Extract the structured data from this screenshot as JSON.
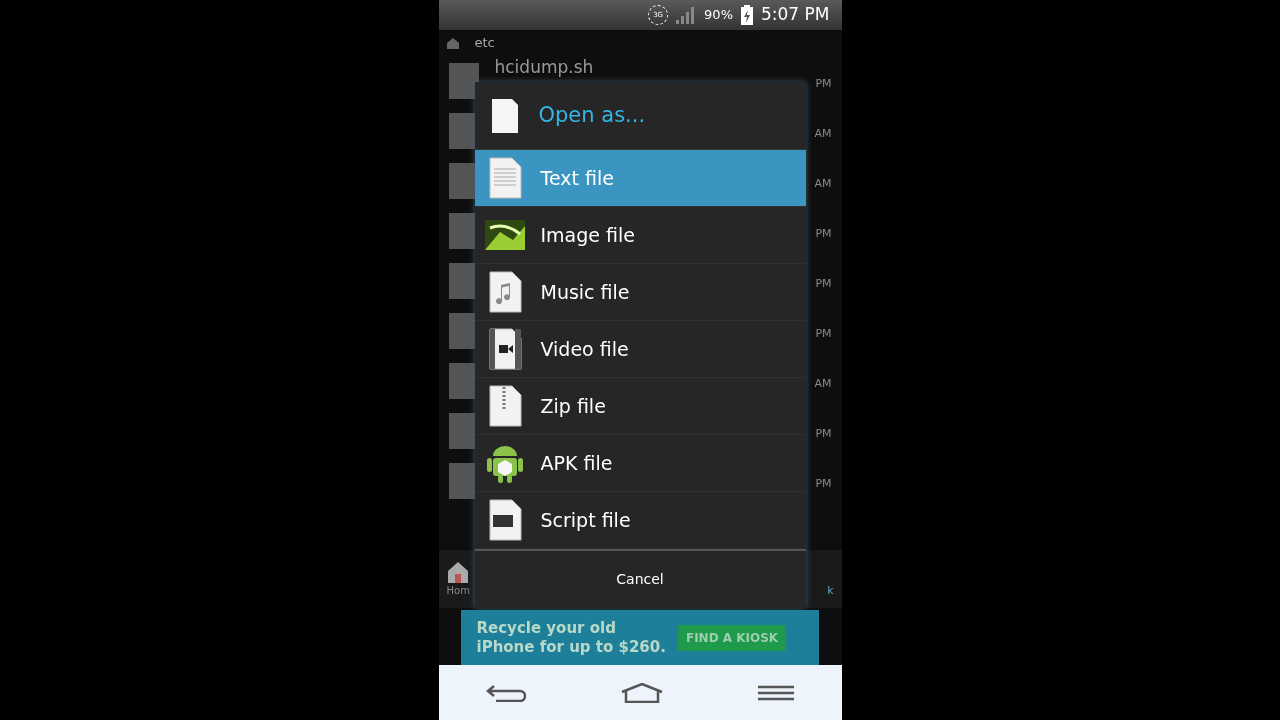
{
  "status_bar": {
    "network": "3G",
    "battery": "90%",
    "time": "5:07 PM"
  },
  "breadcrumb": "etc",
  "files": [
    {
      "name": "hcidump.sh",
      "time": "PM"
    },
    {
      "time": "AM"
    },
    {
      "time": "AM"
    },
    {
      "time": "PM"
    },
    {
      "time": "PM"
    },
    {
      "time": "PM"
    },
    {
      "time": "AM"
    },
    {
      "time": "PM"
    },
    {
      "time": "PM"
    }
  ],
  "bottom_bar": {
    "left": "Hom",
    "right": "k"
  },
  "dialog": {
    "title": "Open as...",
    "items": [
      {
        "kind": "text",
        "label": "Text file",
        "selected": true
      },
      {
        "kind": "image",
        "label": "Image file",
        "selected": false
      },
      {
        "kind": "music",
        "label": "Music file",
        "selected": false
      },
      {
        "kind": "video",
        "label": "Video file",
        "selected": false
      },
      {
        "kind": "zip",
        "label": "Zip file",
        "selected": false
      },
      {
        "kind": "apk",
        "label": "APK file",
        "selected": false
      },
      {
        "kind": "script",
        "label": "Script file",
        "selected": false
      }
    ],
    "cancel": "Cancel"
  },
  "ad": {
    "line1": "Recycle your old",
    "line2": "iPhone for up to $260.",
    "button": "FIND A KIOSK"
  }
}
